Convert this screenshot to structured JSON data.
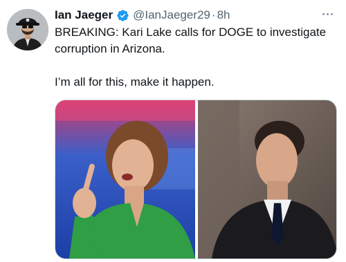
{
  "author": {
    "display_name": "Ian Jaeger",
    "handle": "@IanJaeger29",
    "separator": "·",
    "timestamp": "8h",
    "verified": true
  },
  "tweet": {
    "paragraphs": [
      "BREAKING: Kari Lake calls for DOGE to investigate corruption in Arizona.",
      "I’m all for this, make it happen."
    ]
  },
  "media": {
    "images": [
      {
        "description_icon": "photo-woman-pointing"
      },
      {
        "description_icon": "photo-man-in-suit"
      }
    ]
  },
  "colors": {
    "verified_blue": "#1d9bf0",
    "secondary_text": "#536471",
    "primary_text": "#0f1419"
  },
  "icons": {
    "verified": "verified-badge-icon",
    "more": "more-options-icon"
  }
}
